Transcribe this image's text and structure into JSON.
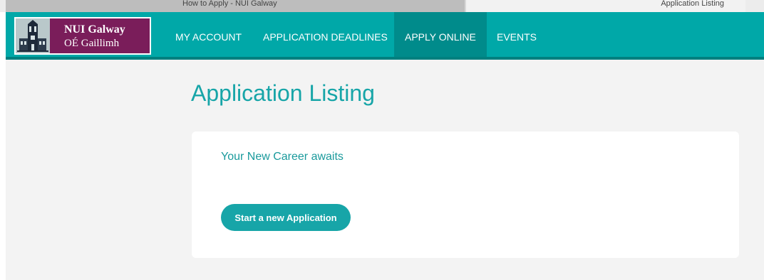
{
  "browser_tabs": [
    {
      "title": "How to Apply - NUI Galway"
    },
    {
      "title": "Application Listing"
    }
  ],
  "logo": {
    "line1": "NUI Galway",
    "line2": "OÉ Gaillimh"
  },
  "nav": {
    "items": [
      {
        "label": "MY ACCOUNT",
        "active": false
      },
      {
        "label": "APPLICATION DEADLINES",
        "active": false
      },
      {
        "label": "APPLY ONLINE",
        "active": true
      },
      {
        "label": "EVENTS",
        "active": false
      }
    ]
  },
  "main": {
    "title": "Application Listing",
    "card": {
      "heading": "Your New Career awaits",
      "button_label": "Start a new Application"
    }
  },
  "colors": {
    "nav_bg": "#00a8a8",
    "nav_active": "#008b8b",
    "logo_bg": "#7a1d5a",
    "accent": "#17a5a8"
  }
}
